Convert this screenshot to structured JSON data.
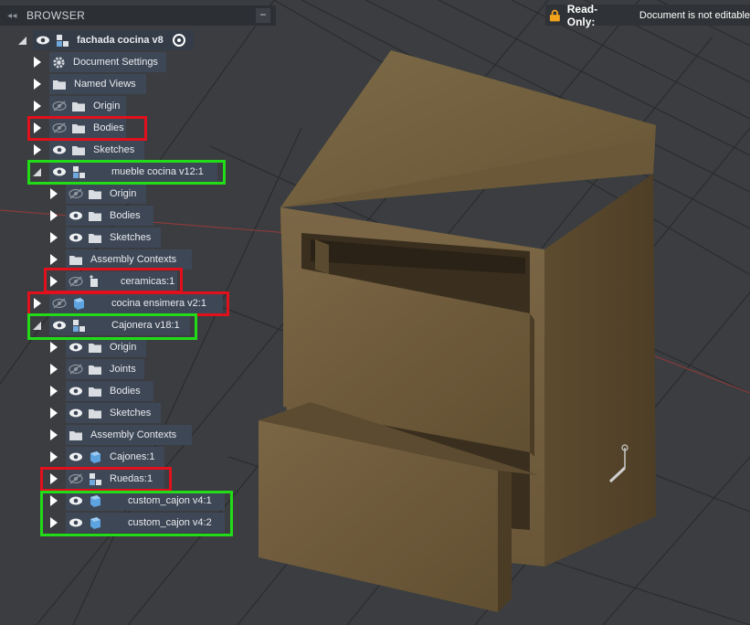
{
  "browser": {
    "title": "BROWSER",
    "collapse_glyph": "−",
    "back_glyph": "◂◂"
  },
  "status": {
    "label": "Read-Only:",
    "message": "Document is not editable"
  },
  "tree": {
    "root": {
      "label": "fachada cocina v8"
    },
    "doc_settings": {
      "label": "Document Settings"
    },
    "named_views": {
      "label": "Named Views"
    },
    "origin": {
      "label": "Origin"
    },
    "bodies": {
      "label": "Bodies"
    },
    "sketches": {
      "label": "Sketches"
    },
    "mueble": {
      "label": "mueble cocina v12:1",
      "origin": "Origin",
      "bodies": "Bodies",
      "sketches": "Sketches",
      "assembly": "Assembly Contexts",
      "ceramicas": "ceramicas:1"
    },
    "cocina_ensimera": {
      "label": "cocina ensimera v2:1"
    },
    "cajonera": {
      "label": "Cajonera v18:1",
      "origin": "Origin",
      "joints": "Joints",
      "bodies": "Bodies",
      "sketches": "Sketches",
      "assembly": "Assembly Contexts",
      "cajones": "Cajones:1",
      "ruedas": "Ruedas:1",
      "custom1": "custom_cajon v4:1",
      "custom2": "custom_cajon v4:2"
    }
  },
  "colors": {
    "highlight_red": "#e2101c",
    "highlight_green": "#22dc18",
    "wood": "#6e5b3c",
    "viewport_bg": "#3b3d40",
    "panel_row": "#3e4756"
  }
}
